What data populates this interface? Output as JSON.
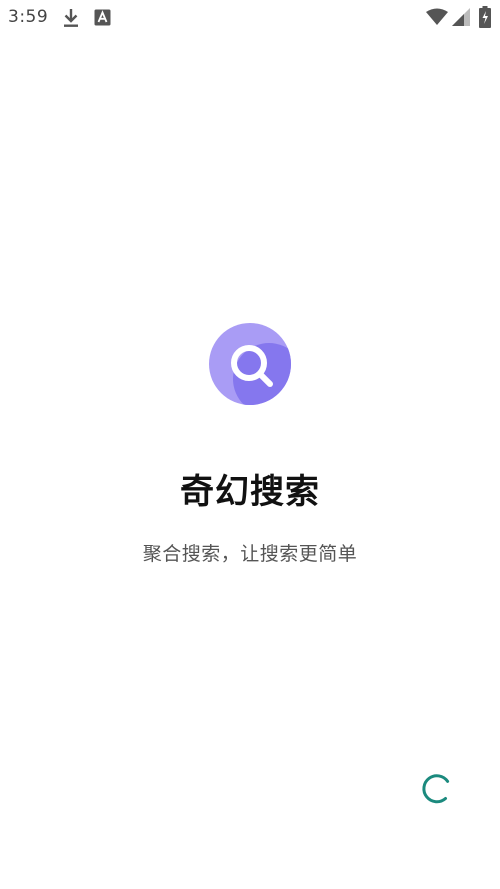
{
  "status_bar": {
    "time": "3:59",
    "icons": [
      "download-icon",
      "font-a-icon",
      "wifi-icon",
      "signal-icon",
      "battery-icon"
    ]
  },
  "splash": {
    "logo_icon": "search-logo-icon",
    "title": "奇幻搜索",
    "subtitle": "聚合搜索，让搜索更简单",
    "loading_icon": "loading-spinner-icon"
  },
  "colors": {
    "logo_light": "#a99cf5",
    "logo_dark": "#8577ee",
    "spinner": "#1b8a7e",
    "title": "#111111",
    "subtitle": "#555555"
  }
}
